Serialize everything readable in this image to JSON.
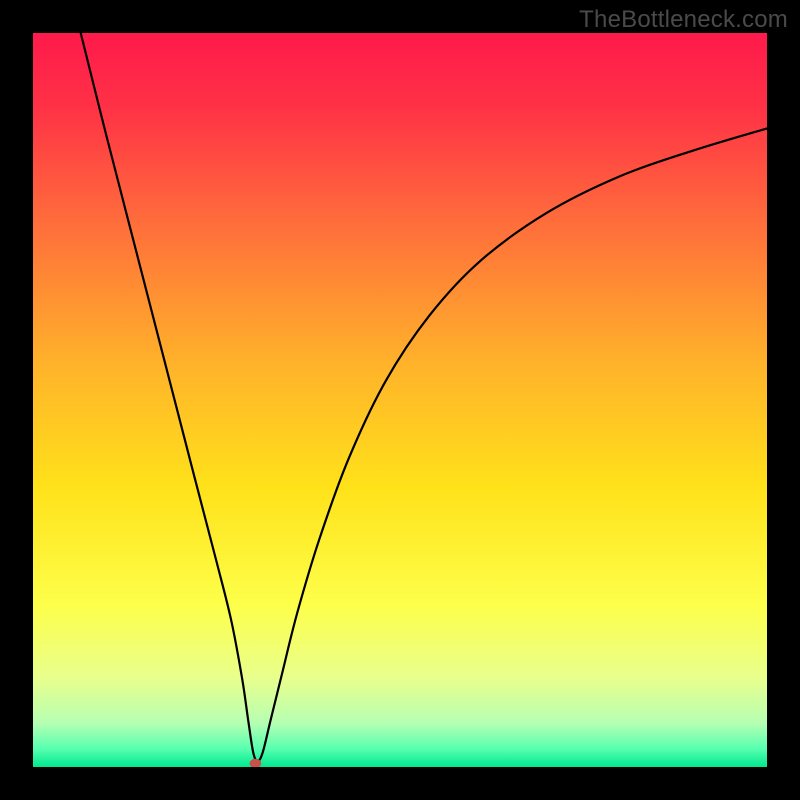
{
  "watermark": "TheBottleneck.com",
  "chart_data": {
    "type": "line",
    "title": "",
    "xlabel": "",
    "ylabel": "",
    "xlim": [
      0,
      100
    ],
    "ylim": [
      0,
      100
    ],
    "grid": false,
    "legend": false,
    "background_gradient": {
      "stops": [
        {
          "offset": 0.0,
          "color": "#ff1a4b"
        },
        {
          "offset": 0.1,
          "color": "#ff3146"
        },
        {
          "offset": 0.25,
          "color": "#ff6a3c"
        },
        {
          "offset": 0.45,
          "color": "#ffb22a"
        },
        {
          "offset": 0.62,
          "color": "#ffe21a"
        },
        {
          "offset": 0.78,
          "color": "#fdff4a"
        },
        {
          "offset": 0.88,
          "color": "#e8ff8e"
        },
        {
          "offset": 0.94,
          "color": "#b6ffb2"
        },
        {
          "offset": 0.975,
          "color": "#58ffb0"
        },
        {
          "offset": 1.0,
          "color": "#00e98e"
        }
      ]
    },
    "series": [
      {
        "name": "bottleneck-curve",
        "x": [
          6.5,
          10,
          14,
          18,
          22,
          25,
          27,
          28.5,
          29.3,
          30,
          30.6,
          31.3,
          32.4,
          34,
          36,
          39,
          43,
          48,
          54,
          61,
          70,
          80,
          90,
          100
        ],
        "y": [
          100,
          86,
          70.5,
          55,
          39.5,
          28,
          20,
          12,
          6.5,
          2,
          0.8,
          2,
          6.5,
          13,
          21,
          31,
          42,
          52.5,
          61.5,
          69,
          75.5,
          80.5,
          84,
          87
        ],
        "color": "#000000",
        "width": 2.2
      }
    ],
    "markers": [
      {
        "name": "minimum-point",
        "x": 30.3,
        "y": 0.5,
        "color": "#c9514b",
        "rx": 5.8,
        "ry": 4.6
      }
    ]
  }
}
